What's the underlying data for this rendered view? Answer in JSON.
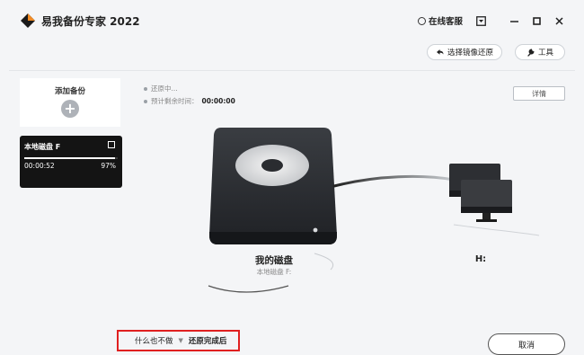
{
  "window": {
    "title": "易我备份专家 2022",
    "online_service": "在线客服"
  },
  "toolbar": {
    "restore_image": "选择镜像还原",
    "tools": "工具"
  },
  "sidebar": {
    "add_backup": "添加备份",
    "task": {
      "name": "本地磁盘 F",
      "elapsed": "00:00:52",
      "percent": "97%",
      "progress": 0.97
    }
  },
  "status": {
    "state": "还原中...",
    "remaining_label": "预计剩余时间：",
    "remaining_value": "00:00:00"
  },
  "details_button": "详情",
  "source": {
    "title": "我的磁盘",
    "subtitle": "本地磁盘 F:"
  },
  "destination": {
    "label": "H:"
  },
  "footer": {
    "after_option": "什么也不做",
    "after_label": "还原完成后",
    "cancel": "取消"
  }
}
